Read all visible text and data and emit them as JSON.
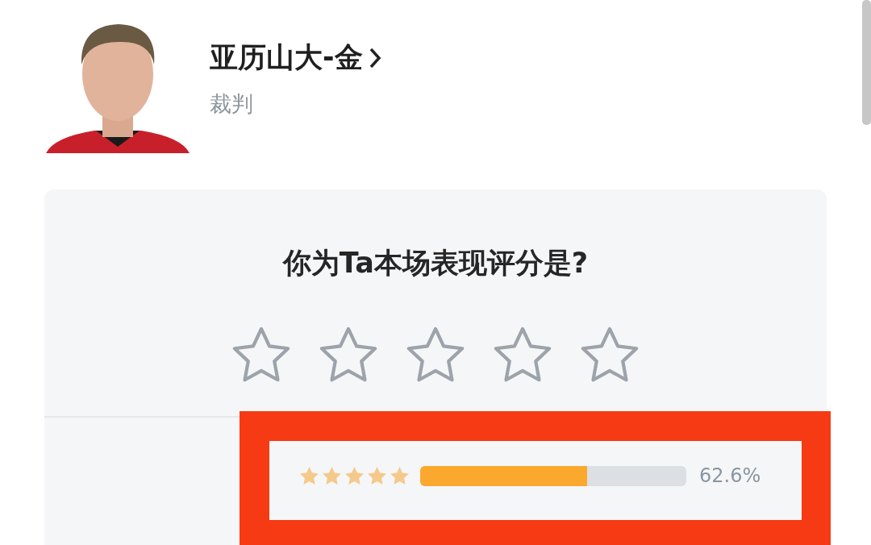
{
  "profile": {
    "name": "亚历山大-金",
    "role": "裁判"
  },
  "rating": {
    "question": "你为Ta本场表现评分是?",
    "stars": 0
  },
  "distribution": [
    {
      "stars": 5,
      "level": 0.626,
      "reading": "62.6%"
    }
  ]
}
